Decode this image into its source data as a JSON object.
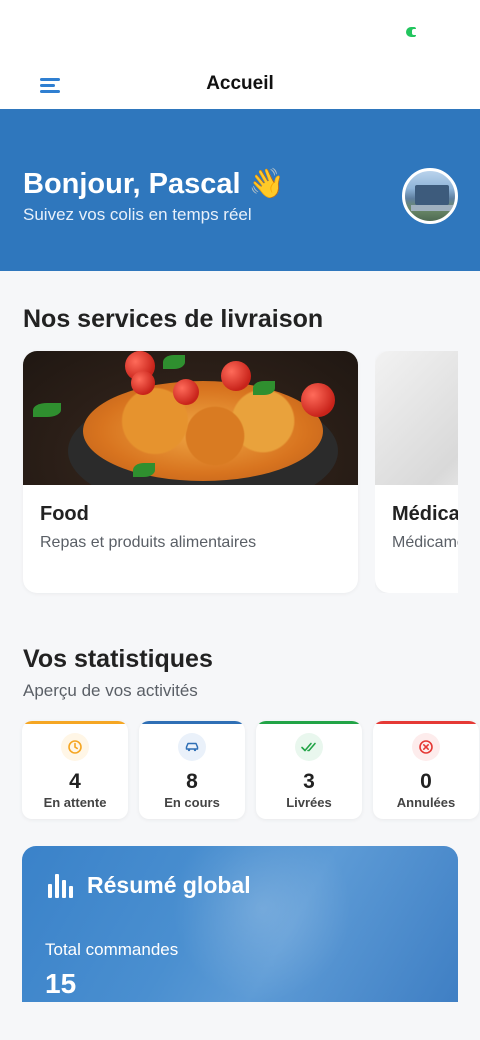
{
  "appbar": {
    "title": "Accueil"
  },
  "hero": {
    "greeting": "Bonjour, Pascal 👋",
    "subtitle": "Suivez vos colis en temps réel"
  },
  "services": {
    "title": "Nos services de livraison",
    "items": [
      {
        "name": "Food",
        "description": "Repas et produits alimentaires"
      },
      {
        "name": "Médicaments",
        "description": "Médicaments"
      }
    ]
  },
  "stats": {
    "title": "Vos statistiques",
    "subtitle": "Aperçu de vos activités",
    "items": [
      {
        "value": "4",
        "label": "En attente",
        "color": "#f5a623",
        "icon": "clock-icon"
      },
      {
        "value": "8",
        "label": "En cours",
        "color": "#2f6fb5",
        "icon": "car-icon"
      },
      {
        "value": "3",
        "label": "Livrées",
        "color": "#22a447",
        "icon": "double-check-icon"
      },
      {
        "value": "0",
        "label": "Annulées",
        "color": "#e53935",
        "icon": "cancel-icon"
      }
    ]
  },
  "summary": {
    "title": "Résumé global",
    "total_label": "Total commandes",
    "total_value": "15"
  },
  "colors": {
    "primary": "#2f77bd",
    "accent": "#2f7fd1",
    "background": "#f6f7f9"
  }
}
